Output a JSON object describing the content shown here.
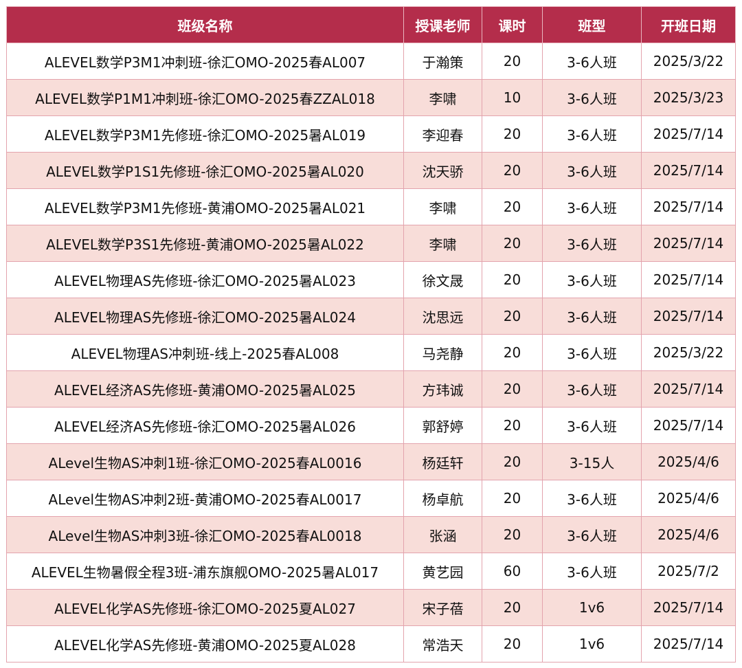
{
  "table": {
    "headers": [
      "班级名称",
      "授课老师",
      "课时",
      "班型",
      "开班日期"
    ],
    "rows": [
      [
        "ALEVEL数学P3M1冲刺班-徐汇OMO-2025春AL007",
        "于瀚策",
        "20",
        "3-6人班",
        "2025/3/22"
      ],
      [
        "ALEVEL数学P1M1冲刺班-徐汇OMO-2025春ZZAL018",
        "李啸",
        "10",
        "3-6人班",
        "2025/3/23"
      ],
      [
        "ALEVEL数学P3M1先修班-徐汇OMO-2025暑AL019",
        "李迎春",
        "20",
        "3-6人班",
        "2025/7/14"
      ],
      [
        "ALEVEL数学P1S1先修班-徐汇OMO-2025暑AL020",
        "沈天骄",
        "20",
        "3-6人班",
        "2025/7/14"
      ],
      [
        "ALEVEL数学P3M1先修班-黄浦OMO-2025暑AL021",
        "李啸",
        "20",
        "3-6人班",
        "2025/7/14"
      ],
      [
        "ALEVEL数学P3S1先修班-黄浦OMO-2025暑AL022",
        "李啸",
        "20",
        "3-6人班",
        "2025/7/14"
      ],
      [
        "ALEVEL物理AS先修班-徐汇OMO-2025暑AL023",
        "徐文晟",
        "20",
        "3-6人班",
        "2025/7/14"
      ],
      [
        "ALEVEL物理AS先修班-徐汇OMO-2025暑AL024",
        "沈思远",
        "20",
        "3-6人班",
        "2025/7/14"
      ],
      [
        "ALEVEL物理AS冲刺班-线上-2025春AL008",
        "马尧静",
        "20",
        "3-6人班",
        "2025/3/22"
      ],
      [
        "ALEVEL经济AS先修班-黄浦OMO-2025暑AL025",
        "方玮诚",
        "20",
        "3-6人班",
        "2025/7/14"
      ],
      [
        "ALEVEL经济AS先修班-徐汇OMO-2025暑AL026",
        "郭舒婷",
        "20",
        "3-6人班",
        "2025/7/14"
      ],
      [
        "ALevel生物AS冲刺1班-徐汇OMO-2025春AL0016",
        "杨廷轩",
        "20",
        "3-15人",
        "2025/4/6"
      ],
      [
        "ALevel生物AS冲刺2班-黄浦OMO-2025春AL0017",
        "杨卓航",
        "20",
        "3-6人班",
        "2025/4/6"
      ],
      [
        "ALevel生物AS冲刺3班-徐汇OMO-2025春AL0018",
        "张涵",
        "20",
        "3-6人班",
        "2025/4/6"
      ],
      [
        "ALEVEL生物暑假全程3班-浦东旗舰OMO-2025暑AL017",
        "黄艺园",
        "60",
        "3-6人班",
        "2025/7/2"
      ],
      [
        "ALEVEL化学AS先修班-徐汇OMO-2025夏AL027",
        "宋子蓓",
        "20",
        "1v6",
        "2025/7/14"
      ],
      [
        "ALEVEL化学AS先修班-黄浦OMO-2025夏AL028",
        "常浩天",
        "20",
        "1v6",
        "2025/7/14"
      ]
    ]
  }
}
